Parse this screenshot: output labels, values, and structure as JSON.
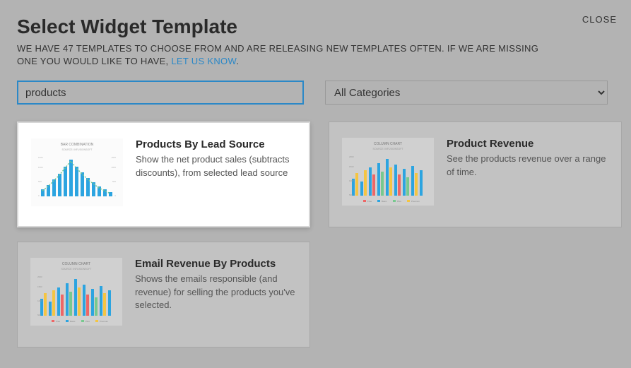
{
  "close_label": "CLOSE",
  "title": "Select Widget Template",
  "subtitle_pre": "WE HAVE 47 TEMPLATES TO CHOOSE FROM AND ARE RELEASING NEW TEMPLATES OFTEN. IF WE ARE MISSING ONE YOU WOULD LIKE TO HAVE, ",
  "subtitle_link": "LET US KNOW",
  "subtitle_post": ".",
  "search": {
    "value": "products",
    "placeholder": ""
  },
  "category": {
    "selected": "All Categories"
  },
  "cards": [
    {
      "title": "Products By Lead Source",
      "desc": "Show the net product sales (subtracts discounts), from selected lead source",
      "thumb_type": "BAR COMBINATION",
      "thumb_sub": "SOURCE: INFUSIONSOFT"
    },
    {
      "title": "Product Revenue",
      "desc": "See the products revenue over a range of time.",
      "thumb_type": "COLUMN CHART",
      "thumb_sub": "SOURCE: INFUSIONSOFT"
    },
    {
      "title": "Email Revenue By Products",
      "desc": "Shows the emails responsible (and revenue) for selling the products you've selected.",
      "thumb_type": "COLUMN CHART",
      "thumb_sub": "SOURCE: INFUSIONSOFT"
    }
  ]
}
